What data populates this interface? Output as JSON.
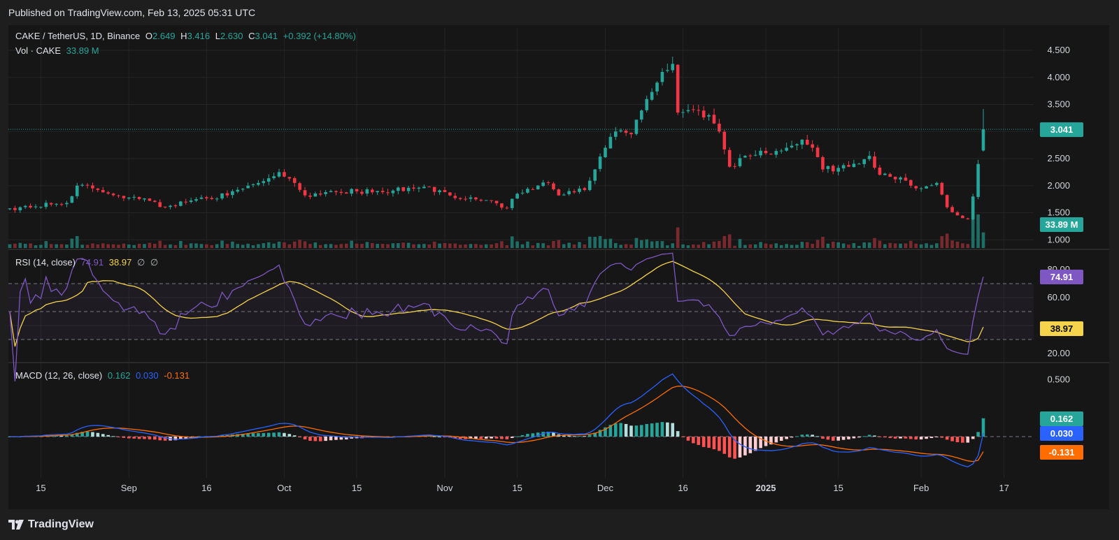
{
  "header": {
    "published": "Published on TradingView.com, Feb 13, 2025 05:31 UTC"
  },
  "footer": {
    "brand": "TradingView"
  },
  "colors": {
    "up": "#26a69a",
    "down": "#f23645",
    "bg": "#161616",
    "grid": "#242424",
    "rsi": "#7e57c2",
    "rsi_ma": "#f5d34a",
    "macd": "#2962ff",
    "signal": "#ff6d00",
    "axis_text": "#d1d4dc"
  },
  "price_legend": {
    "symbol": "CAKE / TetherUS, 1D, Binance",
    "o_label": "O",
    "o": "2.649",
    "h_label": "H",
    "h": "3.416",
    "l_label": "L",
    "l": "2.630",
    "c_label": "C",
    "c": "3.041",
    "change": "+0.392 (+14.80%)",
    "vol_label": "Vol · CAKE",
    "vol": "33.89 M"
  },
  "rsi_legend": {
    "label": "RSI (14, close)",
    "rsi": "74.91",
    "ma": "38.97",
    "extra1": "∅",
    "extra2": "∅"
  },
  "macd_legend": {
    "label": "MACD (12, 26, close)",
    "macd": "0.162",
    "signal": "0.030",
    "hist": "-0.131"
  },
  "badges": {
    "price": "3.041",
    "volume": "33.89 M",
    "rsi": "74.91",
    "rsi_ma": "38.97",
    "macd": "0.162",
    "signal": "0.030",
    "hist": "-0.131"
  },
  "chart_data": {
    "type": "candlestick",
    "price_axis_ticks": [
      "4.500",
      "4.000",
      "3.500",
      "3.000",
      "2.500",
      "2.000",
      "1.500",
      "1.000"
    ],
    "rsi_axis_ticks": [
      "80.00",
      "60.00",
      "20.00"
    ],
    "macd_axis_ticks": [
      "0.500"
    ],
    "x_ticks": [
      "15",
      "Sep",
      "16",
      "Oct",
      "15",
      "Nov",
      "15",
      "Dec",
      "16",
      "2025",
      "15",
      "Feb",
      "17"
    ],
    "ylim_price": [
      0.8,
      4.65
    ],
    "current_price": 3.041,
    "rsi_levels": [
      70,
      50,
      30
    ],
    "date_range": [
      "2024-08-09",
      "2025-02-13"
    ],
    "close_anchors": [
      [
        "2024-08-09",
        1.58
      ],
      [
        "2024-08-20",
        1.68
      ],
      [
        "2024-08-22",
        2.0
      ],
      [
        "2024-08-25",
        1.95
      ],
      [
        "2024-09-01",
        1.78
      ],
      [
        "2024-09-05",
        1.72
      ],
      [
        "2024-09-08",
        1.6
      ],
      [
        "2024-09-15",
        1.78
      ],
      [
        "2024-09-20",
        1.82
      ],
      [
        "2024-09-26",
        2.05
      ],
      [
        "2024-09-30",
        2.25
      ],
      [
        "2024-10-03",
        2.05
      ],
      [
        "2024-10-05",
        1.82
      ],
      [
        "2024-10-10",
        1.9
      ],
      [
        "2024-10-20",
        1.88
      ],
      [
        "2024-10-28",
        1.98
      ],
      [
        "2024-11-02",
        1.82
      ],
      [
        "2024-11-10",
        1.72
      ],
      [
        "2024-11-13",
        1.58
      ],
      [
        "2024-11-15",
        1.85
      ],
      [
        "2024-11-21",
        2.05
      ],
      [
        "2024-11-23",
        1.82
      ],
      [
        "2024-11-28",
        1.92
      ],
      [
        "2024-11-30",
        2.3
      ],
      [
        "2024-12-02",
        2.7
      ],
      [
        "2024-12-04",
        3.0
      ],
      [
        "2024-12-07",
        2.95
      ],
      [
        "2024-12-10",
        3.6
      ],
      [
        "2024-12-13",
        4.1
      ],
      [
        "2024-12-15",
        4.25
      ],
      [
        "2024-12-16",
        3.35
      ],
      [
        "2024-12-19",
        3.4
      ],
      [
        "2024-12-22",
        3.3
      ],
      [
        "2024-12-24",
        3.0
      ],
      [
        "2024-12-26",
        2.35
      ],
      [
        "2024-12-29",
        2.55
      ],
      [
        "2025-01-02",
        2.6
      ],
      [
        "2025-01-06",
        2.7
      ],
      [
        "2025-01-09",
        2.85
      ],
      [
        "2025-01-11",
        2.7
      ],
      [
        "2025-01-13",
        2.3
      ],
      [
        "2025-01-18",
        2.35
      ],
      [
        "2025-01-22",
        2.55
      ],
      [
        "2025-01-24",
        2.2
      ],
      [
        "2025-01-28",
        2.15
      ],
      [
        "2025-01-31",
        1.95
      ],
      [
        "2025-02-04",
        2.05
      ],
      [
        "2025-02-06",
        1.6
      ],
      [
        "2025-02-09",
        1.4
      ],
      [
        "2025-02-10",
        1.38
      ],
      [
        "2025-02-11",
        1.8
      ],
      [
        "2025-02-12",
        2.4
      ],
      [
        "2025-02-13",
        3.041
      ]
    ],
    "volume_note": "Volume bars spike in early Dec and in Feb",
    "rsi_last": 74.91,
    "rsi_ma_last": 38.97,
    "macd_last": 0.162,
    "signal_last": 0.03,
    "hist_last": -0.131
  }
}
